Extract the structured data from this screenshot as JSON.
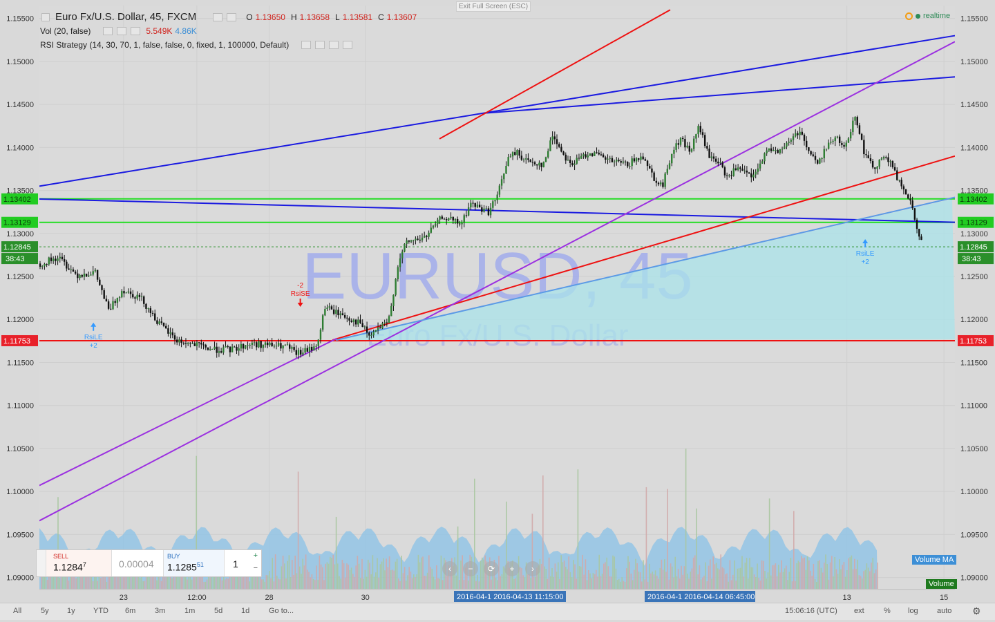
{
  "legend": {
    "title": "Euro Fx/U.S. Dollar, 45, FXCM",
    "o_label": "O",
    "o_value": "1.13650",
    "h_label": "H",
    "h_value": "1.13658",
    "l_label": "L",
    "l_value": "1.13581",
    "c_label": "C",
    "c_value": "1.13607",
    "vol_title": "Vol (20, false)",
    "vol_value1": "5.549K",
    "vol_value2": "4.86K",
    "strategy_title": "RSI Strategy (14, 30, 70, 1, false, false, 0, fixed, 1, 100000, Default)"
  },
  "fullscreen_notice": "Exit Full Screen (ESC)",
  "realtime_label": "realtime",
  "watermark": {
    "symbol": "EURUSD, 45",
    "description": "Euro Fx/U.S. Dollar"
  },
  "trade_panel": {
    "sell_label": "SELL",
    "sell_main": "1.1284",
    "sell_pip": "7",
    "spread": "0.00004",
    "buy_label": "BUY",
    "buy_main": "1.1285",
    "buy_pip": "51",
    "quantity": "1",
    "plus": "+",
    "minus": "−"
  },
  "nav_buttons": [
    "‹",
    "−",
    "⟳",
    "+",
    "›"
  ],
  "bottom_bar": {
    "ranges": [
      "All",
      "5y",
      "1y",
      "YTD",
      "6m",
      "3m",
      "1m",
      "5d",
      "1d"
    ],
    "goto": "Go to...",
    "time": "15:06:16 (UTC)",
    "ext": "ext",
    "percent": "%",
    "log": "log",
    "auto": "auto"
  },
  "volume_ma_label": "Volume MA",
  "volume_label": "Volume",
  "chart_data": {
    "type": "candlestick",
    "symbol": "EURUSD",
    "timeframe": "45",
    "ylim": [
      1.0886,
      1.1565
    ],
    "y_ticks": [
      "1.15500",
      "1.15000",
      "1.14500",
      "1.14000",
      "1.13500",
      "1.13000",
      "1.12500",
      "1.12000",
      "1.11500",
      "1.11000",
      "1.10500",
      "1.10000",
      "1.09500",
      "1.09000"
    ],
    "x_tick_labels": [
      "23",
      "12:00",
      "28",
      "30",
      "13",
      "15"
    ],
    "x_marker_labels": [
      "2016-04-1 2016-04-13 11:15:00",
      "2016-04-1 2016-04-14 06:45:00"
    ],
    "price_tags": [
      {
        "label": "1.13402",
        "value": 1.13402,
        "color": "#22cc22"
      },
      {
        "label": "1.13129",
        "value": 1.13129,
        "color": "#22cc22"
      },
      {
        "label": "1.12845",
        "value": 1.12845,
        "color": "#2a8f2a",
        "countdown": "38:43"
      },
      {
        "label": "1.11753",
        "value": 1.11753,
        "color": "#e8212a"
      }
    ],
    "horizontal_lines": [
      {
        "value": 1.13402,
        "color": "#22dd22"
      },
      {
        "value": 1.13129,
        "color": "#22dd22"
      },
      {
        "value": 1.11753,
        "color": "#ee1111"
      },
      {
        "value": 1.12845,
        "color": "#2a8f2a",
        "dashed": true
      }
    ],
    "signals": [
      {
        "label": "RsiLE",
        "qty": "+2",
        "direction": "long",
        "color": "#3399ff"
      },
      {
        "label": "RsiSE",
        "qty": "-2",
        "direction": "short",
        "color": "#ee1111"
      },
      {
        "label": "RsiLE",
        "qty": "+2",
        "direction": "long",
        "color": "#3399ff"
      }
    ],
    "price_path": [
      [
        0,
        1.1265
      ],
      [
        0.02,
        1.1272
      ],
      [
        0.04,
        1.1252
      ],
      [
        0.06,
        1.1255
      ],
      [
        0.075,
        1.121
      ],
      [
        0.09,
        1.1235
      ],
      [
        0.11,
        1.1225
      ],
      [
        0.13,
        1.1195
      ],
      [
        0.15,
        1.1175
      ],
      [
        0.17,
        1.117
      ],
      [
        0.19,
        1.1165
      ],
      [
        0.21,
        1.1165
      ],
      [
        0.23,
        1.1172
      ],
      [
        0.25,
        1.117
      ],
      [
        0.27,
        1.1168
      ],
      [
        0.28,
        1.116
      ],
      [
        0.295,
        1.1165
      ],
      [
        0.305,
        1.1175
      ],
      [
        0.31,
        1.1215
      ],
      [
        0.33,
        1.1205
      ],
      [
        0.35,
        1.1195
      ],
      [
        0.36,
        1.118
      ],
      [
        0.37,
        1.119
      ],
      [
        0.38,
        1.1195
      ],
      [
        0.385,
        1.1225
      ],
      [
        0.39,
        1.126
      ],
      [
        0.4,
        1.129
      ],
      [
        0.42,
        1.1295
      ],
      [
        0.44,
        1.132
      ],
      [
        0.46,
        1.131
      ],
      [
        0.47,
        1.1335
      ],
      [
        0.49,
        1.1325
      ],
      [
        0.5,
        1.1345
      ],
      [
        0.51,
        1.1385
      ],
      [
        0.52,
        1.1395
      ],
      [
        0.53,
        1.1385
      ],
      [
        0.55,
        1.138
      ],
      [
        0.56,
        1.1415
      ],
      [
        0.57,
        1.1395
      ],
      [
        0.58,
        1.138
      ],
      [
        0.6,
        1.1395
      ],
      [
        0.62,
        1.1385
      ],
      [
        0.64,
        1.138
      ],
      [
        0.66,
        1.139
      ],
      [
        0.67,
        1.1365
      ],
      [
        0.68,
        1.1355
      ],
      [
        0.69,
        1.1395
      ],
      [
        0.7,
        1.141
      ],
      [
        0.71,
        1.1395
      ],
      [
        0.72,
        1.1425
      ],
      [
        0.73,
        1.139
      ],
      [
        0.74,
        1.1385
      ],
      [
        0.75,
        1.1365
      ],
      [
        0.76,
        1.1375
      ],
      [
        0.77,
        1.137
      ],
      [
        0.78,
        1.1365
      ],
      [
        0.79,
        1.139
      ],
      [
        0.8,
        1.14
      ],
      [
        0.81,
        1.1395
      ],
      [
        0.82,
        1.141
      ],
      [
        0.83,
        1.142
      ],
      [
        0.84,
        1.1395
      ],
      [
        0.85,
        1.138
      ],
      [
        0.86,
        1.1405
      ],
      [
        0.87,
        1.141
      ],
      [
        0.88,
        1.14
      ],
      [
        0.89,
        1.144
      ],
      [
        0.9,
        1.1395
      ],
      [
        0.91,
        1.1375
      ],
      [
        0.92,
        1.139
      ],
      [
        0.93,
        1.138
      ],
      [
        0.94,
        1.1355
      ],
      [
        0.95,
        1.134
      ],
      [
        0.955,
        1.1315
      ],
      [
        0.96,
        1.13
      ],
      [
        0.965,
        1.1285
      ]
    ]
  }
}
